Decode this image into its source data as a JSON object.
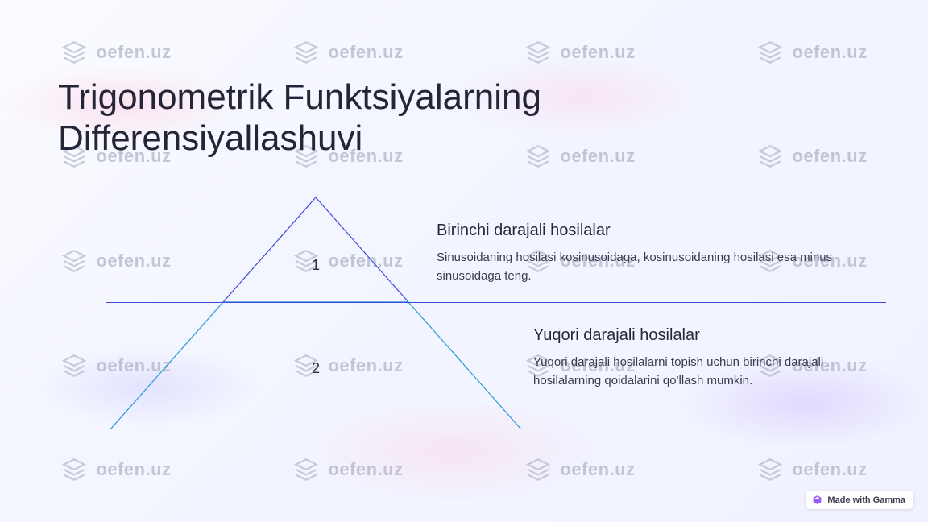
{
  "watermark_text": "oefen.uz",
  "title": "Trigonometrik Funktsiyalarning Differensiyallashuvi",
  "tiers": [
    {
      "num": "1",
      "heading": "Birinchi darajali hosilalar",
      "body": "Sinusoidaning hosilasi kosinusoidaga, kosinusoidaning hosilasi esa minus sinusoidaga teng."
    },
    {
      "num": "2",
      "heading": "Yuqori darajali hosilalar",
      "body": "Yuqori darajali hosilalarni topish uchun birinchi darajali hosilalarning qoidalarini qo'llash mumkin."
    }
  ],
  "badge_label": "Made with Gamma"
}
